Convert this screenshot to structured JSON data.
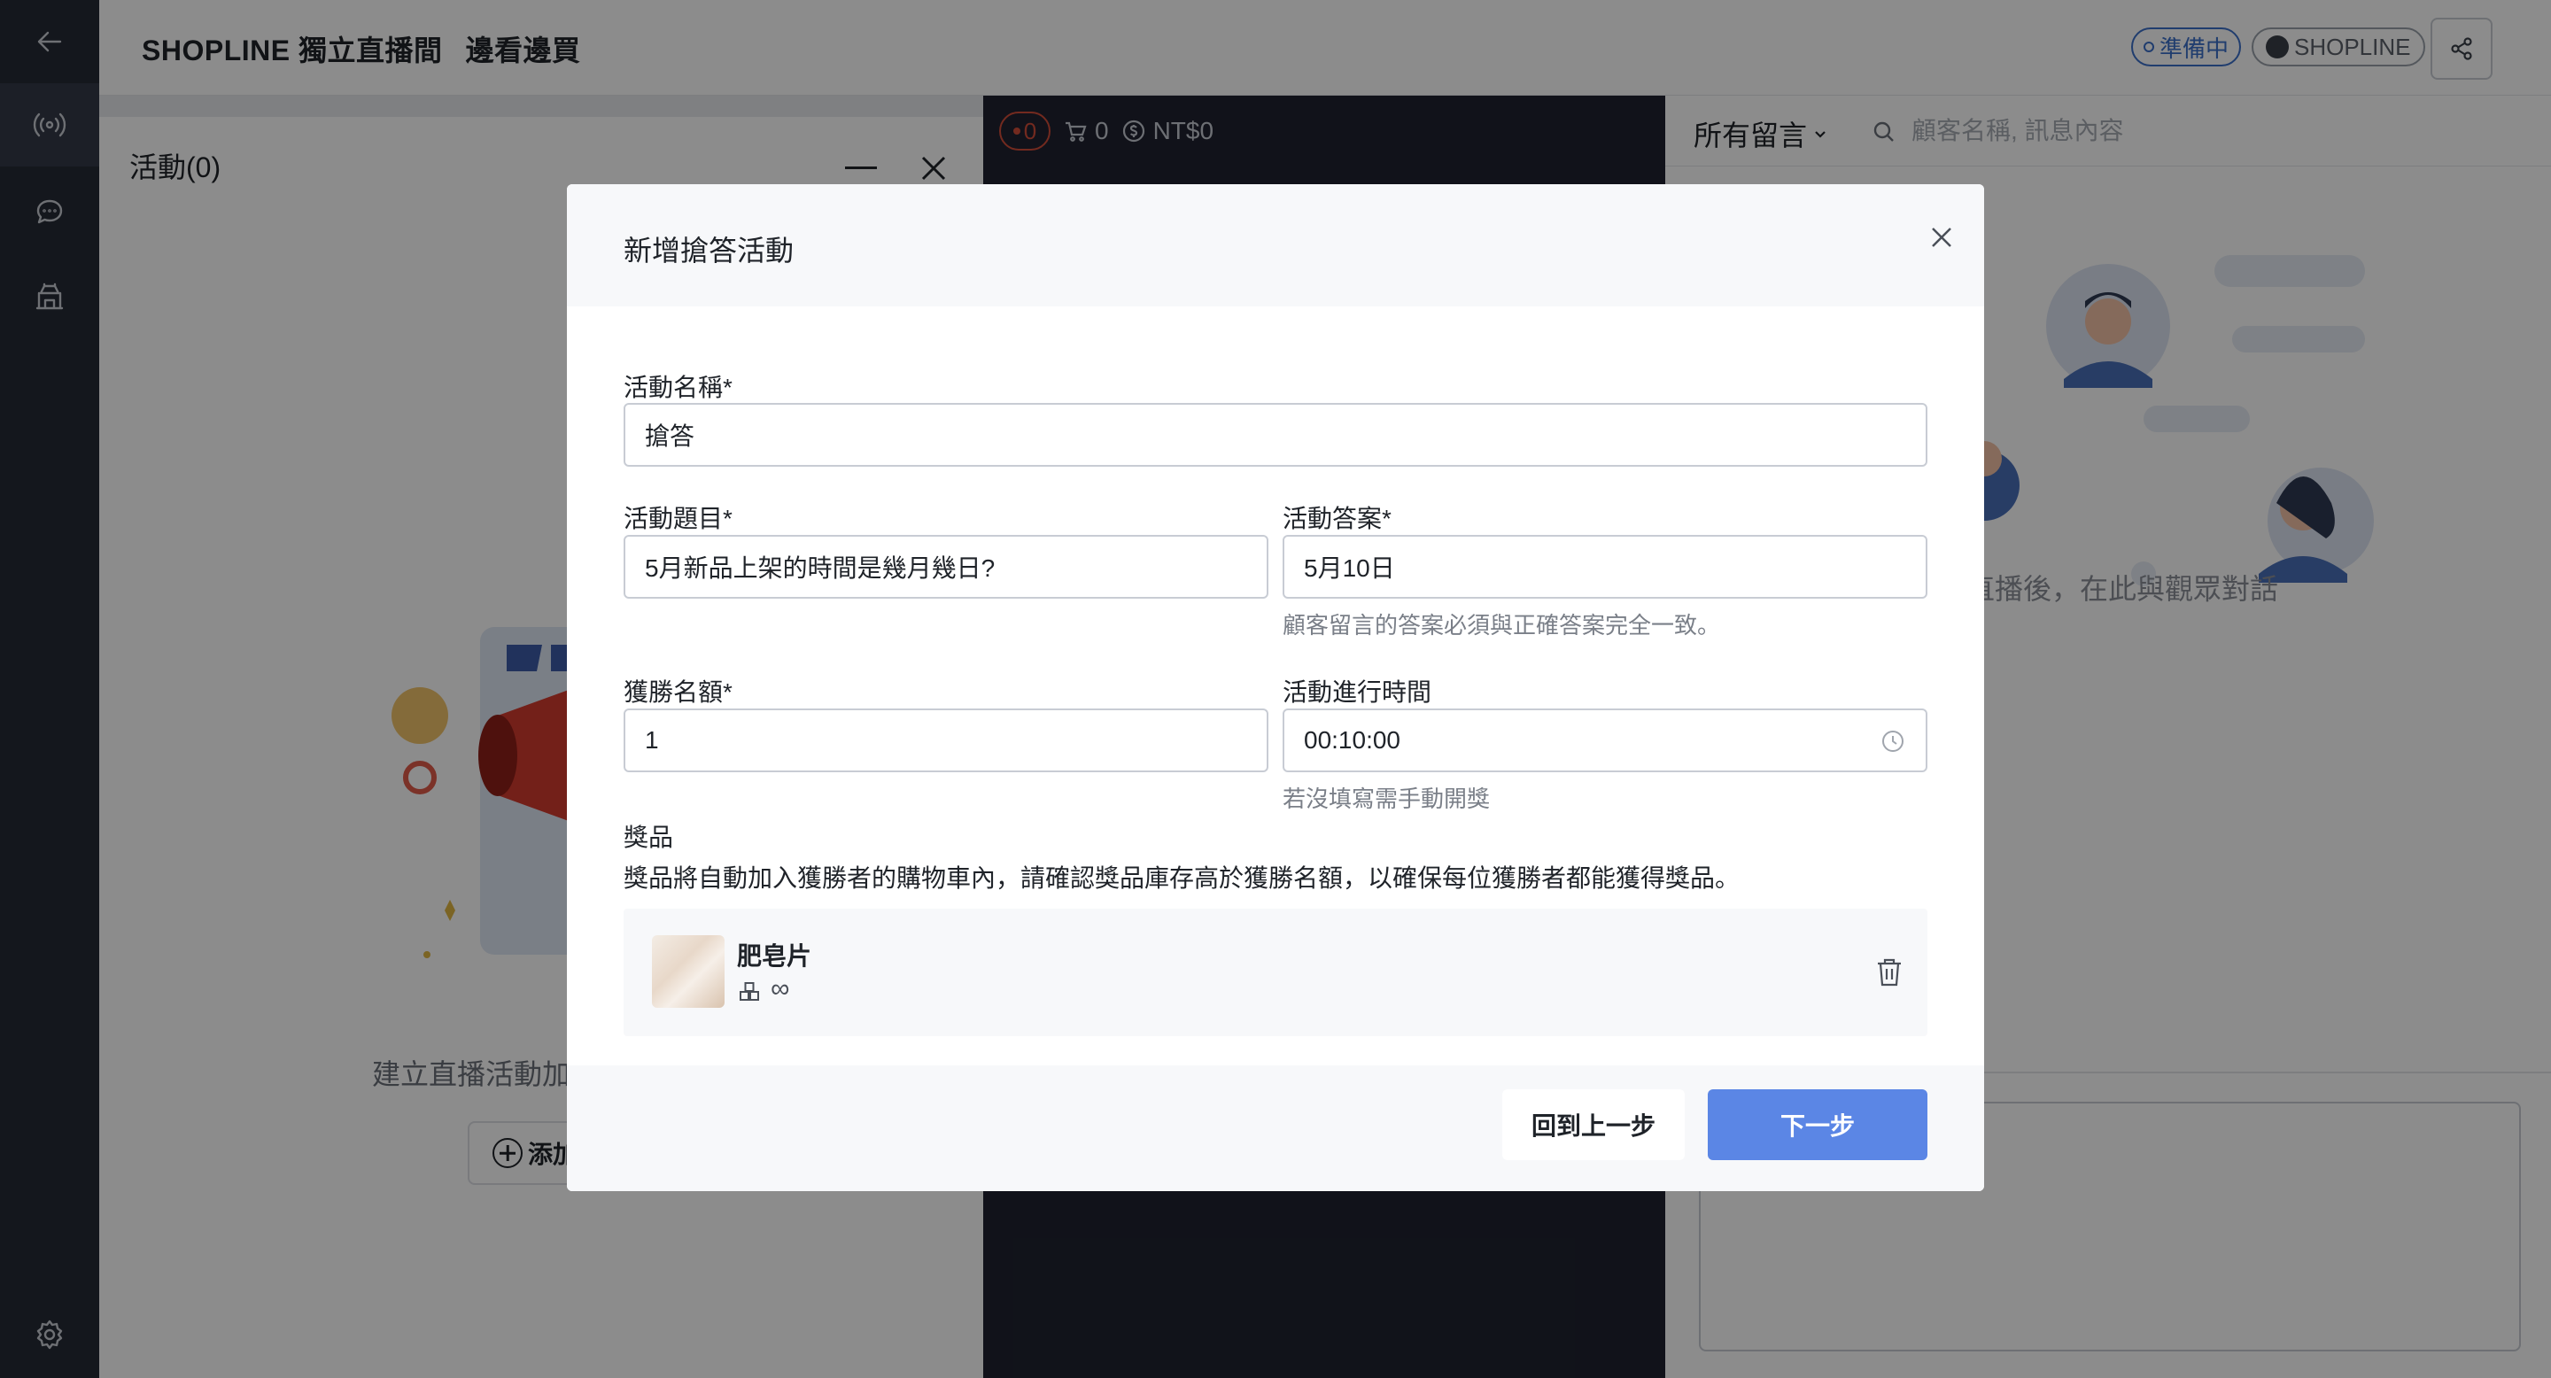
{
  "header": {
    "title_part1": "SHOPLINE 獨立直播間",
    "title_part2": "邊看邊買",
    "status_badge": "準備中",
    "brand_badge": "SHOPLINE"
  },
  "sidebar": {
    "items": [
      {
        "icon": "back-arrow-icon"
      },
      {
        "icon": "live-broadcast-icon"
      },
      {
        "icon": "chat-icon"
      },
      {
        "icon": "store-icon"
      },
      {
        "icon": "gear-icon"
      }
    ]
  },
  "activity_panel": {
    "title": "活動(0)",
    "empty_text": "建立直播活動加",
    "add_button": "添加"
  },
  "video_panel": {
    "viewers": "0",
    "cart_count": "0",
    "sales": "NT$0"
  },
  "comments_panel": {
    "filter": "所有留言",
    "search_placeholder": "顧客名稱, 訊息內容",
    "empty_text": "直播後，在此與觀眾對話"
  },
  "modal": {
    "title": "新增搶答活動",
    "name_label": "活動名稱*",
    "name_value": "搶答",
    "question_label": "活動題目*",
    "question_value": "5月新品上架的時間是幾月幾日?",
    "answer_label": "活動答案*",
    "answer_value": "5月10日",
    "answer_hint": "顧客留言的答案必須與正確答案完全一致。",
    "winners_label": "獲勝名額*",
    "winners_value": "1",
    "duration_label": "活動進行時間",
    "duration_value": "00:10:00",
    "duration_hint": "若沒填寫需手動開獎",
    "prize_label": "獎品",
    "prize_note": "獎品將自動加入獲勝者的購物車內，請確認獎品庫存高於獲勝名額，以確保每位獲勝者都能獲得獎品。",
    "prize_name": "肥皂片",
    "prize_stock": "∞",
    "back_button": "回到上一步",
    "next_button": "下一步"
  },
  "colors": {
    "accent": "#5b86e5",
    "sidebar": "#252a35",
    "status_blue": "#3b6fc9",
    "live_red": "#d14d3a"
  }
}
